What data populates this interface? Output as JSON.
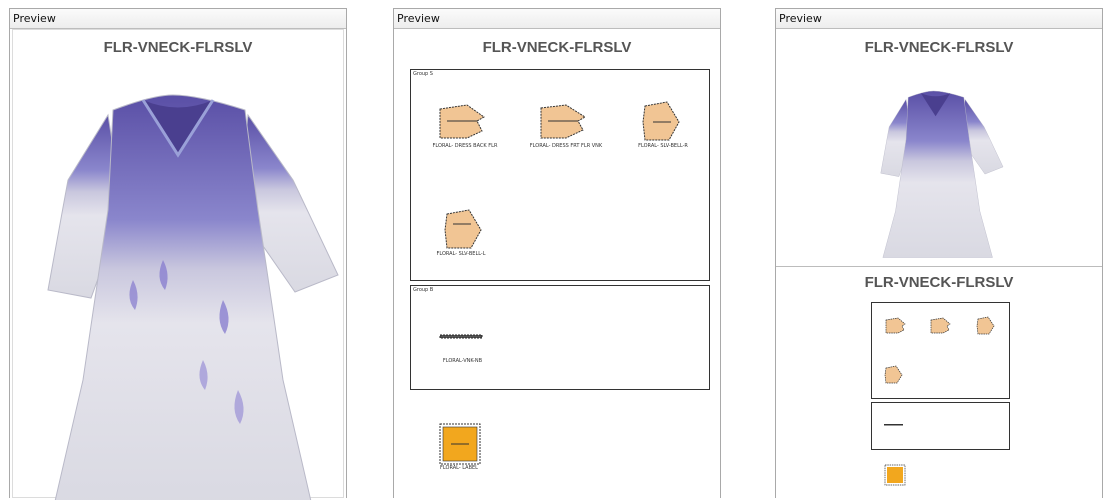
{
  "panels": [
    {
      "title": "Preview",
      "heading": "FLR-VNECK-FLRSLV"
    },
    {
      "title": "Preview",
      "heading": "FLR-VNECK-FLRSLV"
    },
    {
      "title": "Preview",
      "heading_top": "FLR-VNECK-FLRSLV",
      "heading_bottom": "FLR-VNECK-FLRSLV"
    }
  ],
  "marker": {
    "groups": [
      {
        "label": "Group S",
        "pieces": [
          "FLORAL- DRESS BACK FLR",
          "FLORAL- DRESS FRT FLR VNK",
          "FLORAL- SLV-BELL-R",
          "FLORAL- SLV-BELL-L"
        ]
      },
      {
        "label": "Group B",
        "pieces": [
          "FLORAL-VNK-NB"
        ]
      }
    ],
    "label_piece": "FLORAL- LABEL"
  },
  "colors": {
    "fabric": "#f1c594",
    "label": "#f2a71e",
    "dress_purple": "#6f63b8",
    "dress_grey": "#e3e3ea",
    "panel_border": "#a9a9a9"
  }
}
